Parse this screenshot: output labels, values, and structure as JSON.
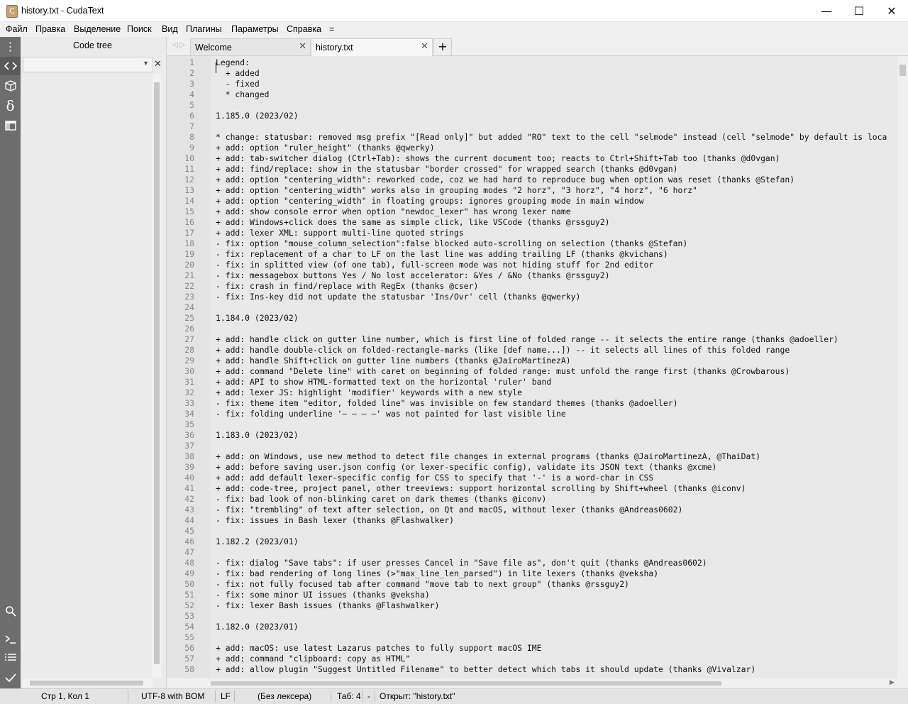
{
  "window": {
    "title": "history.txt - CudaText",
    "app_icon_letter": "C",
    "min_symbol": "—",
    "max_symbol": "☐",
    "close_symbol": "✕"
  },
  "menu": [
    "Файл",
    "Правка",
    "Выделение",
    "Поиск",
    "Вид",
    "Плагины",
    "Параметры",
    "Справка",
    "="
  ],
  "sidebar": {
    "icons": [
      "menu-icon",
      "code-tree-icon",
      "project-icon",
      "snippets-icon",
      "tabs-icon",
      "search-icon",
      "console-icon",
      "output-icon",
      "validate-icon"
    ]
  },
  "panel": {
    "title": "Code tree",
    "arrows": "◁ ▷",
    "combo_value": "",
    "close_symbol": "✕"
  },
  "tabs": [
    {
      "label": "Welcome",
      "active": false
    },
    {
      "label": "history.txt",
      "active": true
    }
  ],
  "tab_add": "+",
  "editor": {
    "lines": [
      "Legend:",
      "  + added",
      "  - fixed",
      "  * changed",
      "",
      "1.185.0 (2023/02)",
      "",
      "* change: statusbar: removed msg prefix \"[Read only]\" but added \"RO\" text to the cell \"selmode\" instead (cell \"selmode\" by default is loca",
      "+ add: option \"ruler_height\" (thanks @qwerky)",
      "+ add: tab-switcher dialog (Ctrl+Tab): shows the current document too; reacts to Ctrl+Shift+Tab too (thanks @d0vgan)",
      "+ add: find/replace: show in the statusbar \"border crossed\" for wrapped search (thanks @d0vgan)",
      "+ add: option \"centering_width\": reworked code, coz we had hard to reproduce bug when option was reset (thanks @Stefan)",
      "+ add: option \"centering_width\" works also in grouping modes \"2 horz\", \"3 horz\", \"4 horz\", \"6 horz\"",
      "+ add: option \"centering_width\" in floating groups: ignores grouping mode in main window",
      "+ add: show console error when option \"newdoc_lexer\" has wrong lexer name",
      "+ add: Windows+click does the same as simple click, like VSCode (thanks @rssguy2)",
      "+ add: lexer XML: support multi-line quoted strings",
      "- fix: option \"mouse_column_selection\":false blocked auto-scrolling on selection (thanks @Stefan)",
      "- fix: replacement of a char to LF on the last line was adding trailing LF (thanks @kvichans)",
      "- fix: in splitted view (of one tab), full-screen mode was not hiding stuff for 2nd editor",
      "- fix: messagebox buttons Yes / No lost accelerator: &Yes / &No (thanks @rssguy2)",
      "- fix: crash in find/replace with RegEx (thanks @cser)",
      "- fix: Ins-key did not update the statusbar 'Ins/Ovr' cell (thanks @qwerky)",
      "",
      "1.184.0 (2023/02)",
      "",
      "+ add: handle click on gutter line number, which is first line of folded range -- it selects the entire range (thanks @adoeller)",
      "+ add: handle double-click on folded-rectangle-marks (like [def name...]) -- it selects all lines of this folded range",
      "+ add: handle Shift+click on gutter line numbers (thanks @JairoMartinezA)",
      "+ add: command \"Delete line\" with caret on beginning of folded range: must unfold the range first (thanks @Crowbarous)",
      "+ add: API to show HTML-formatted text on the horizontal 'ruler' band",
      "+ add: lexer JS: highlight 'modifier' keywords with a new style",
      "- fix: theme item \"editor, folded line\" was invisible on few standard themes (thanks @adoeller)",
      "- fix: folding underline '— — — —' was not painted for last visible line",
      "",
      "1.183.0 (2023/02)",
      "",
      "+ add: on Windows, use new method to detect file changes in external programs (thanks @JairoMartinezA, @ThaiDat)",
      "+ add: before saving user.json config (or lexer-specific config), validate its JSON text (thanks @xcme)",
      "+ add: add default lexer-specific config for CSS to specify that '-' is a word-char in CSS",
      "+ add: code-tree, project panel, other treeviews: support horizontal scrolling by Shift+wheel (thanks @iconv)",
      "- fix: bad look of non-blinking caret on dark themes (thanks @iconv)",
      "- fix: \"trembling\" of text after selection, on Qt and macOS, without lexer (thanks @Andreas0602)",
      "- fix: issues in Bash lexer (thanks @Flashwalker)",
      "",
      "1.182.2 (2023/01)",
      "",
      "- fix: dialog \"Save tabs\": if user presses Cancel in \"Save file as\", don't quit (thanks @Andreas0602)",
      "- fix: bad rendering of long lines (>\"max_line_len_parsed\") in lite lexers (thanks @veksha)",
      "- fix: not fully focused tab after command \"move tab to next group\" (thanks @rssguy2)",
      "- fix: some minor UI issues (thanks @veksha)",
      "- fix: lexer Bash issues (thanks @Flashwalker)",
      "",
      "1.182.0 (2023/01)",
      "",
      "+ add: macOS: use latest Lazarus patches to fully support macOS IME",
      "+ add: command \"clipboard: copy as HTML\"",
      "+ add: allow plugin \"Suggest Untitled Filename\" to better detect which tabs it should update (thanks @Vivalzar)"
    ]
  },
  "status": {
    "position": "Стр 1, Кол 1",
    "encoding": "UTF-8 with BOM",
    "line_ending": "LF",
    "lexer": "(Без лексера)",
    "tab_size": "Таб: 4",
    "dash": "-",
    "message": "Открыт: \"history.txt\""
  }
}
